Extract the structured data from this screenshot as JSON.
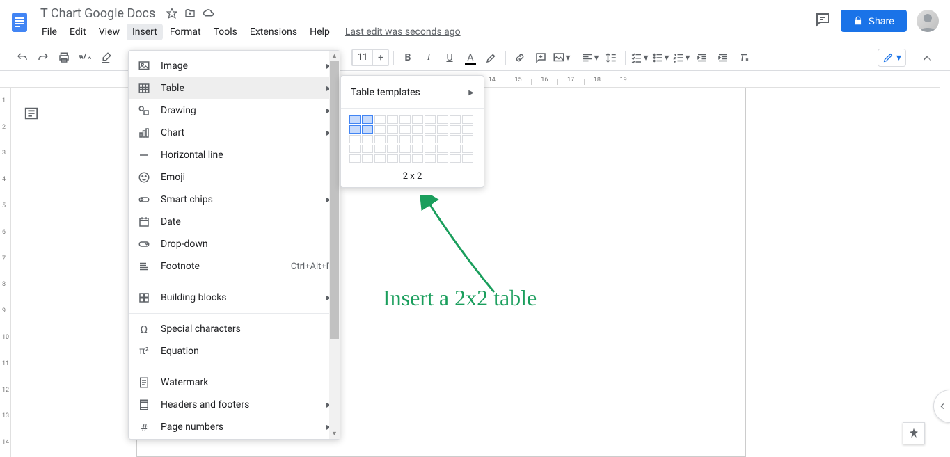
{
  "doc_title": "T Chart Google Docs",
  "menubar": [
    "File",
    "Edit",
    "View",
    "Insert",
    "Format",
    "Tools",
    "Extensions",
    "Help"
  ],
  "active_menu_index": 3,
  "last_edit": "Last edit was seconds ago",
  "share_label": "Share",
  "font_size": "11",
  "insert_menu": {
    "groups": [
      [
        {
          "icon": "image",
          "label": "Image",
          "arrow": true
        },
        {
          "icon": "table",
          "label": "Table",
          "arrow": true,
          "hover": true
        },
        {
          "icon": "drawing",
          "label": "Drawing",
          "arrow": true
        },
        {
          "icon": "chart",
          "label": "Chart",
          "arrow": true
        },
        {
          "icon": "hr",
          "label": "Horizontal line"
        },
        {
          "icon": "emoji",
          "label": "Emoji"
        },
        {
          "icon": "chips",
          "label": "Smart chips",
          "arrow": true
        },
        {
          "icon": "date",
          "label": "Date"
        },
        {
          "icon": "dropdown",
          "label": "Drop-down"
        },
        {
          "icon": "footnote",
          "label": "Footnote",
          "shortcut": "Ctrl+Alt+F"
        }
      ],
      [
        {
          "icon": "blocks",
          "label": "Building blocks",
          "arrow": true
        }
      ],
      [
        {
          "icon": "omega",
          "label": "Special characters"
        },
        {
          "icon": "pi",
          "label": "Equation"
        }
      ],
      [
        {
          "icon": "watermark",
          "label": "Watermark"
        },
        {
          "icon": "headers",
          "label": "Headers and footers",
          "arrow": true
        },
        {
          "icon": "pagenum",
          "label": "Page numbers",
          "arrow": true
        }
      ]
    ]
  },
  "table_submenu": {
    "templates_label": "Table templates",
    "grid_label": "2 x 2",
    "selected_rows": 2,
    "selected_cols": 2
  },
  "ruler_h_max": 19,
  "ruler_v_max": 14,
  "annotation_text": "Insert a 2x2 table"
}
